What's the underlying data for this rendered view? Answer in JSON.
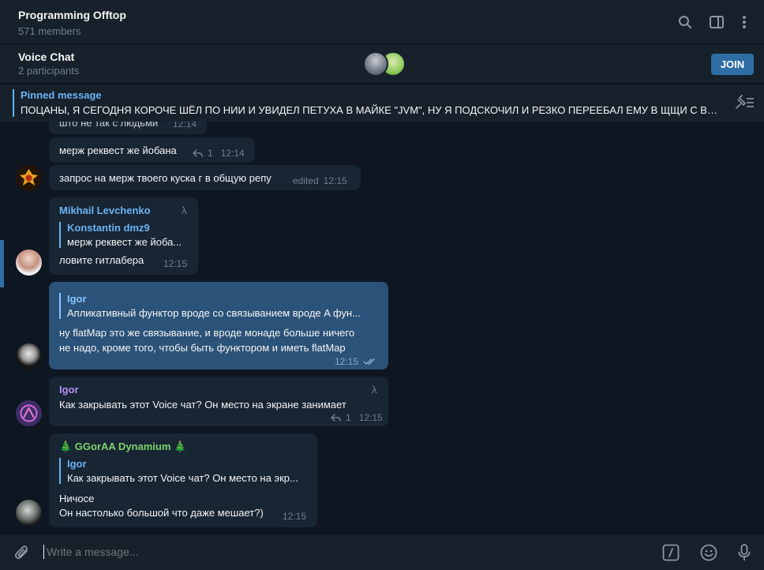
{
  "header": {
    "title": "Programming Offtop",
    "subtitle": "571 members",
    "icons": [
      "search-icon",
      "sidebar-toggle-icon",
      "more-vertical-icon"
    ]
  },
  "voice_chat": {
    "title": "Voice Chat",
    "subtitle": "2 participants",
    "join_label": "JOIN"
  },
  "pinned": {
    "label": "Pinned message",
    "text": "ПОЦАНЫ, Я СЕГОДНЯ КОРОЧЕ ШЁЛ ПО НИИ И УВИДЕЛ ПЕТУХА В МАЙКЕ \"JVM\", НУ Я ПОДСКОЧИЛ И РЕЗКО ПЕРЕЕБАЛ ЕМУ В ЩЩИ С ВЕРТ..."
  },
  "messages": [
    {
      "text": "што не так с людьми",
      "time": "12:14"
    },
    {
      "text": "мерж реквест же йобана",
      "replies": "1",
      "time": "12:14"
    },
    {
      "text": "запрос на мерж твоего куска г в общую репу",
      "edited": "edited",
      "time": "12:15"
    },
    {
      "sender": "Mikhail Levchenko",
      "badge": "λ",
      "reply_name": "Konstantin dmz9",
      "reply_text": "мерж реквест же йоба...",
      "text": "ловите гитлабера",
      "time": "12:15"
    },
    {
      "reply_name": "Igor",
      "reply_text": "Апликативный функтор вроде со связыванием вроде A фун...",
      "line1": "ну flatMap это же связывание, и вроде монаде больше ничего",
      "line2": "не надо, кроме того, чтобы быть функтором и иметь flatMap",
      "time": "12:15"
    },
    {
      "sender": "Igor",
      "badge": "λ",
      "text": "Как закрывать этот Voice чат? Он место на экране занимает",
      "replies": "1",
      "time": "12:15"
    },
    {
      "sender": "🎄 GGorAA Dynamium 🎄",
      "reply_name": "Igor",
      "reply_text": "Как закрывать этот Voice чат? Он место на экр...",
      "line1": "Ничосе",
      "line2": "Он настолько большой что даже мешает?)",
      "time": "12:15"
    }
  ],
  "composer": {
    "placeholder": "Write a message..."
  },
  "colors": {
    "background": "#0e1621",
    "panel": "#17212b",
    "bubble_in": "#182533",
    "bubble_out": "#2b5278",
    "accent": "#6ab3f3",
    "join_button": "#2f6ea5",
    "sender_igor": "#b28ff0",
    "sender_ggoraa": "#7dd36d"
  }
}
